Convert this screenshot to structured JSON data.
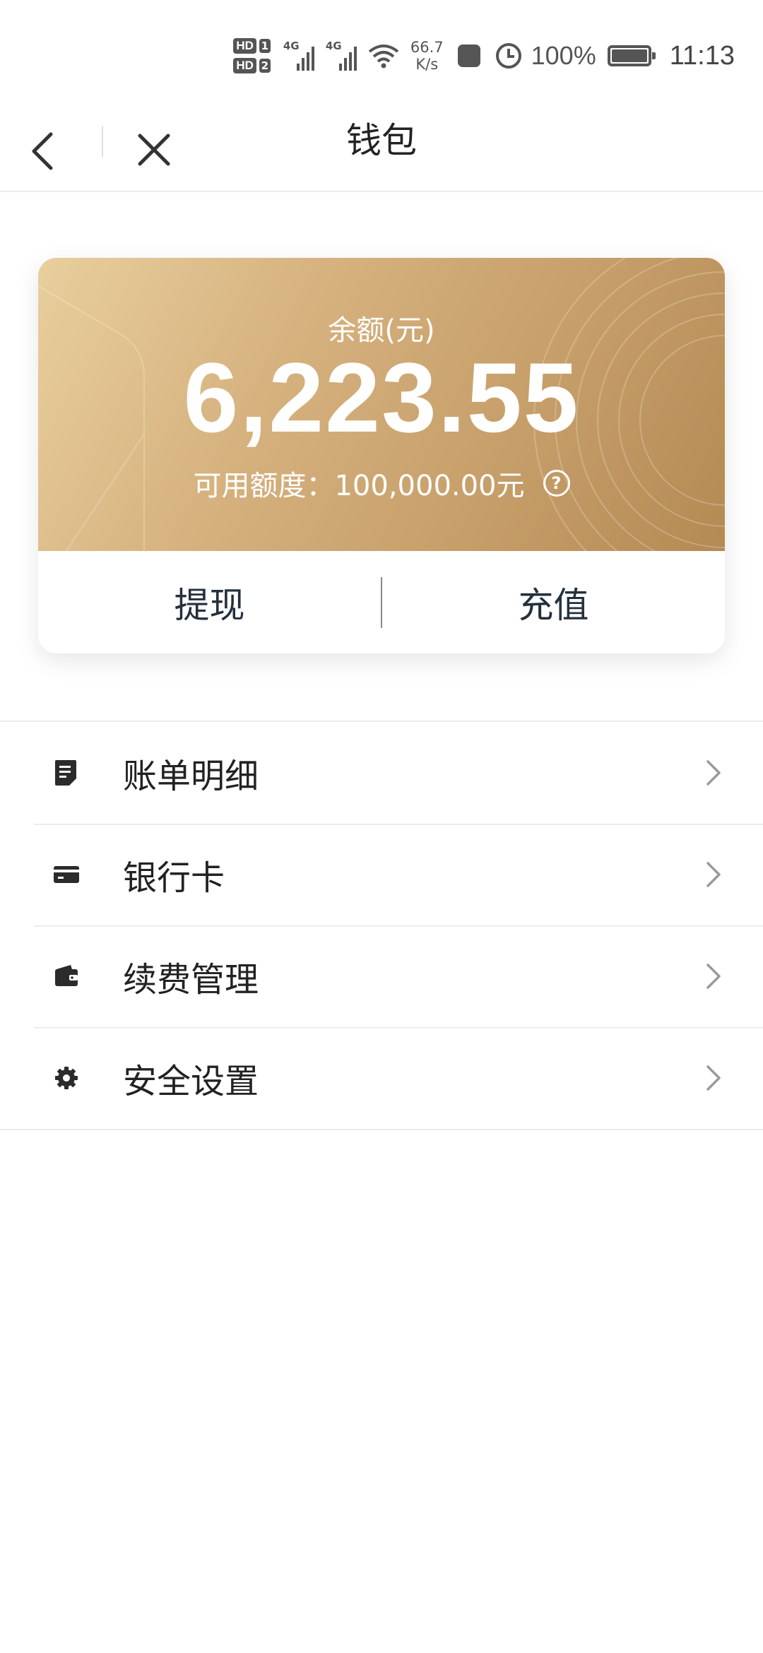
{
  "status_bar": {
    "sim1": "HD",
    "sim1_num": "1",
    "sim2": "HD",
    "sim2_num": "2",
    "signal_label_1": "4G",
    "signal_label_2": "4G",
    "net_speed_value": "66.7",
    "net_speed_unit": "K/s",
    "battery_percent": "100%",
    "time": "11:13",
    "icons": [
      "wifi-icon",
      "app-notification-icon",
      "alarm-icon",
      "battery-charging-icon"
    ]
  },
  "navbar": {
    "title": "钱包",
    "back_icon": "chevron-left-icon",
    "close_icon": "close-icon"
  },
  "wallet_card": {
    "balance_label": "余额(元)",
    "balance_amount": "6,223.55",
    "limit_text": "可用额度：100,000.00元",
    "help_icon_glyph": "?",
    "withdraw_label": "提现",
    "recharge_label": "充值",
    "gradient_colors": [
      "#e8cf9d",
      "#d6b27f",
      "#c59d68",
      "#b48a54"
    ]
  },
  "menu": {
    "items": [
      {
        "label": "账单明细",
        "icon": "bill-icon"
      },
      {
        "label": "银行卡",
        "icon": "bank-card-icon"
      },
      {
        "label": "续费管理",
        "icon": "wallet-icon"
      },
      {
        "label": "安全设置",
        "icon": "gear-icon"
      }
    ]
  }
}
